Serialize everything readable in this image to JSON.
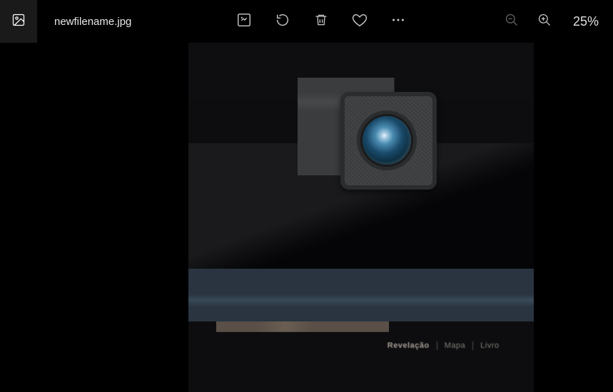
{
  "header": {
    "filename": "newfilename.jpg",
    "zoom_label": "25%"
  },
  "icons": {
    "image": "image-icon",
    "edit": "edit-image-icon",
    "rotate": "rotate-icon",
    "delete": "trash-icon",
    "favorite": "heart-icon",
    "more": "more-icon",
    "zoom_out": "zoom-out-icon",
    "zoom_in": "zoom-in-icon"
  },
  "image_content": {
    "screen_words": [
      "Revelação",
      "Mapa",
      "Livro"
    ]
  }
}
